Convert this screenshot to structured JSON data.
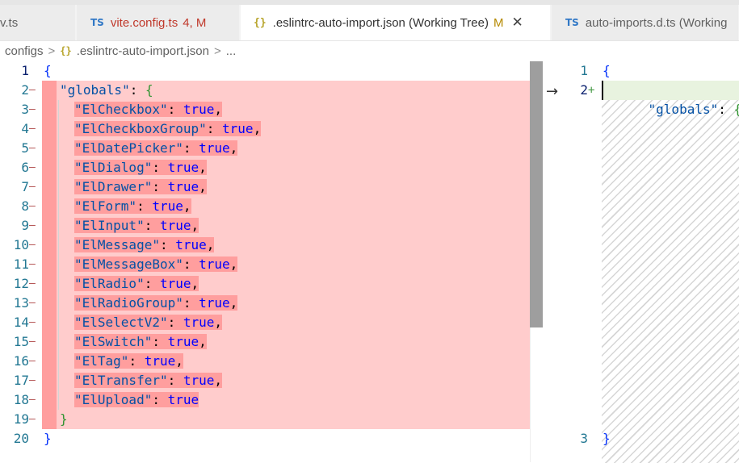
{
  "tabs": [
    {
      "label": "v.ts"
    },
    {
      "icon": "TS",
      "label": "vite.config.ts",
      "status": "4, M"
    },
    {
      "icon": "{}",
      "label": ".eslintrc-auto-import.json (Working Tree)",
      "status": "M",
      "close": "✕"
    },
    {
      "icon": "TS",
      "label": "auto-imports.d.ts (Working"
    }
  ],
  "breadcrumb": {
    "part1": "configs",
    "sep": ">",
    "icon": "{}",
    "part2": ".eslintrc-auto-import.json",
    "part3": "..."
  },
  "left_lines": [
    {
      "n": "1",
      "text": "{"
    },
    {
      "n": "2",
      "text": "\"globals\": {"
    },
    {
      "n": "3",
      "key": "\"ElCheckbox\"",
      "val": "true",
      "end": ","
    },
    {
      "n": "4",
      "key": "\"ElCheckboxGroup\"",
      "val": "true",
      "end": ","
    },
    {
      "n": "5",
      "key": "\"ElDatePicker\"",
      "val": "true",
      "end": ","
    },
    {
      "n": "6",
      "key": "\"ElDialog\"",
      "val": "true",
      "end": ","
    },
    {
      "n": "7",
      "key": "\"ElDrawer\"",
      "val": "true",
      "end": ","
    },
    {
      "n": "8",
      "key": "\"ElForm\"",
      "val": "true",
      "end": ","
    },
    {
      "n": "9",
      "key": "\"ElInput\"",
      "val": "true",
      "end": ","
    },
    {
      "n": "10",
      "key": "\"ElMessage\"",
      "val": "true",
      "end": ","
    },
    {
      "n": "11",
      "key": "\"ElMessageBox\"",
      "val": "true",
      "end": ","
    },
    {
      "n": "12",
      "key": "\"ElRadio\"",
      "val": "true",
      "end": ","
    },
    {
      "n": "13",
      "key": "\"ElRadioGroup\"",
      "val": "true",
      "end": ","
    },
    {
      "n": "14",
      "key": "\"ElSelectV2\"",
      "val": "true",
      "end": ","
    },
    {
      "n": "15",
      "key": "\"ElSwitch\"",
      "val": "true",
      "end": ","
    },
    {
      "n": "16",
      "key": "\"ElTag\"",
      "val": "true",
      "end": ","
    },
    {
      "n": "17",
      "key": "\"ElTransfer\"",
      "val": "true",
      "end": ","
    },
    {
      "n": "18",
      "key": "\"ElUpload\"",
      "val": "true",
      "end": ""
    },
    {
      "n": "19",
      "text": "}"
    },
    {
      "n": "20",
      "text": "}"
    }
  ],
  "right_lines": [
    {
      "n": "1",
      "text": "{"
    },
    {
      "n": "2",
      "text": "\"globals\": {}"
    },
    {
      "n": "3",
      "text": "}"
    }
  ],
  "diff_marker_deleted": "—",
  "diff_marker_added": "+",
  "revert_arrow": "→"
}
